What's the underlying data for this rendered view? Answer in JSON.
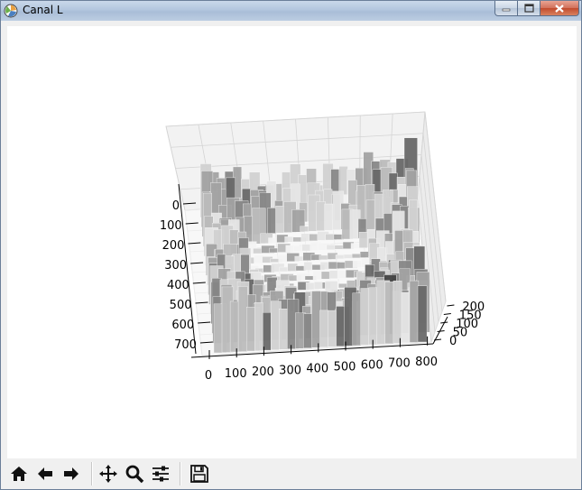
{
  "window": {
    "title": "Canal L"
  },
  "toolbar": {
    "buttons": [
      {
        "name": "home-icon"
      },
      {
        "name": "back-arrow-icon"
      },
      {
        "name": "forward-arrow-icon"
      },
      {
        "name": "pan-icon"
      },
      {
        "name": "zoom-icon"
      },
      {
        "name": "configure-subplots-icon"
      },
      {
        "name": "save-icon"
      }
    ]
  },
  "plot": {
    "x_ticks": [
      "0",
      "100",
      "200",
      "300",
      "400",
      "500",
      "600",
      "700",
      "800"
    ],
    "y_ticks": [
      "0",
      "100",
      "200",
      "300",
      "400",
      "500",
      "600",
      "700"
    ],
    "z_ticks": [
      "0",
      "50",
      "100",
      "150",
      "200"
    ]
  }
}
